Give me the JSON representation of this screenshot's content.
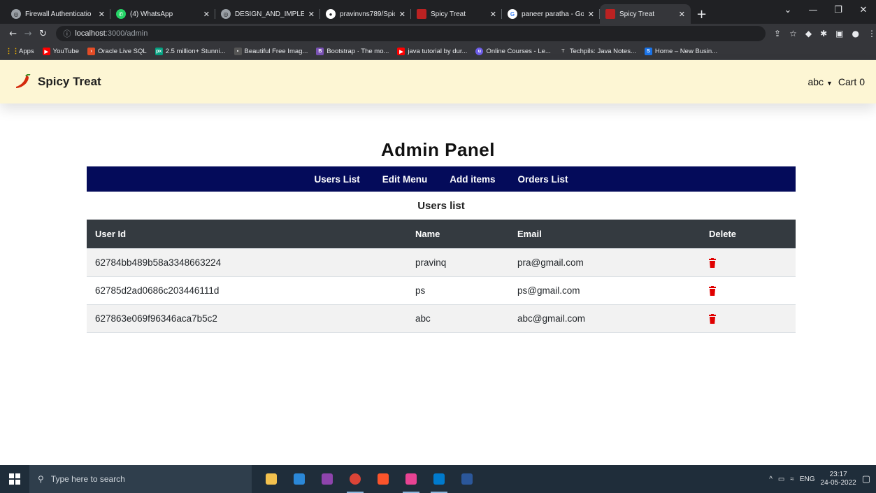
{
  "browser": {
    "tabs": [
      {
        "label": "Firewall Authenticatio",
        "active": false
      },
      {
        "label": "(4) WhatsApp",
        "active": false
      },
      {
        "label": "DESIGN_AND_IMPLEM",
        "active": false
      },
      {
        "label": "pravinvns789/Spicy_Tr",
        "active": false
      },
      {
        "label": "Spicy Treat",
        "active": false
      },
      {
        "label": "paneer paratha - Goo",
        "active": false
      },
      {
        "label": "Spicy Treat",
        "active": true
      }
    ],
    "new_tab": "+",
    "url_host": "localhost",
    "url_path": ":3000/admin",
    "bookmarks": [
      {
        "label": "Apps",
        "color": "#f4b400"
      },
      {
        "label": "YouTube",
        "color": "#ff0000"
      },
      {
        "label": "Oracle Live SQL",
        "color": "#e34c26"
      },
      {
        "label": "2.5 million+ Stunni...",
        "color": "#05a081"
      },
      {
        "label": "Beautiful Free Imag...",
        "color": "#555555"
      },
      {
        "label": "Bootstrap · The mo...",
        "color": "#7952b3"
      },
      {
        "label": "java tutorial by dur...",
        "color": "#ff0000"
      },
      {
        "label": "Online Courses - Le...",
        "color": "#6c5ce7"
      },
      {
        "label": "Techpils: Java Notes...",
        "color": "#888888"
      },
      {
        "label": "Home – New Busin...",
        "color": "#1a73e8"
      }
    ]
  },
  "app": {
    "brand": "Spicy Treat",
    "user_menu": "abc",
    "cart": "Cart 0"
  },
  "page": {
    "title": "Admin Panel",
    "admin_nav": [
      "Users List",
      "Edit Menu",
      "Add items",
      "Orders List"
    ],
    "subtitle": "Users list",
    "columns": [
      "User Id",
      "Name",
      "Email",
      "Delete"
    ],
    "rows": [
      {
        "id": "62784bb489b58a3348663224",
        "name": "pravinq",
        "email": "pra@gmail.com"
      },
      {
        "id": "62785d2ad0686c203446111d",
        "name": "ps",
        "email": "ps@gmail.com"
      },
      {
        "id": "627863e069f96346aca7b5c2",
        "name": "abc",
        "email": "abc@gmail.com"
      }
    ]
  },
  "taskbar": {
    "search_placeholder": "Type here to search",
    "language": "ENG",
    "time": "23:17",
    "date": "24-05-2022"
  },
  "colors": {
    "navbar_bg": "#fdf6d4",
    "admin_bar": "#040b5a",
    "table_header": "#343a40",
    "delete_icon": "#e00000"
  }
}
